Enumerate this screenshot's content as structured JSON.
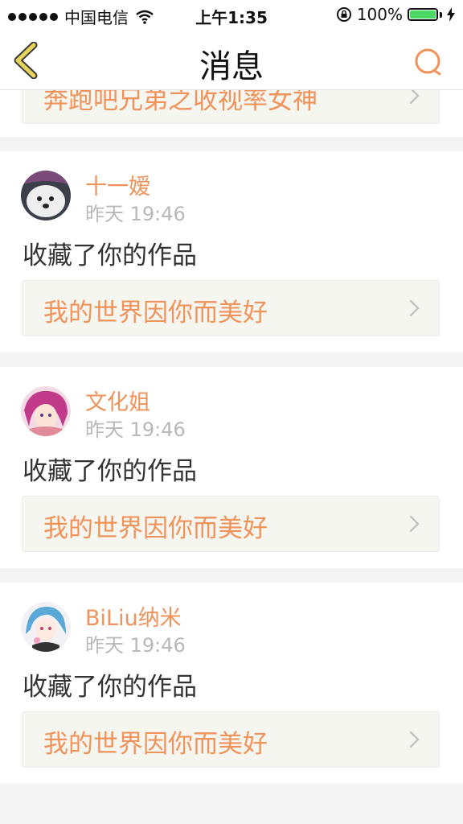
{
  "status_bar": {
    "carrier": "中国电信",
    "time": "上午1:35",
    "battery": "100%",
    "battery_level": 1.0
  },
  "nav": {
    "title": "消息",
    "back_icon": "back-chevron-icon",
    "search_icon": "search-icon"
  },
  "partial_item": {
    "work_title": "奔跑吧兄弟之收视率女神"
  },
  "items": [
    {
      "name": "十一嫒",
      "time": "昨天 19:46",
      "action": "收藏了你的作品",
      "work_title": "我的世界因你而美好"
    },
    {
      "name": "文化姐",
      "time": "昨天 19:46",
      "action": "收藏了你的作品",
      "work_title": "我的世界因你而美好"
    },
    {
      "name": "BiLiu纳米",
      "time": "昨天 19:46",
      "action": "收藏了你的作品",
      "work_title": "我的世界因你而美好"
    }
  ],
  "colors": {
    "accent": "#f0935a",
    "back_icon_stroke": "#e8d45a",
    "battery": "#4cd964"
  }
}
